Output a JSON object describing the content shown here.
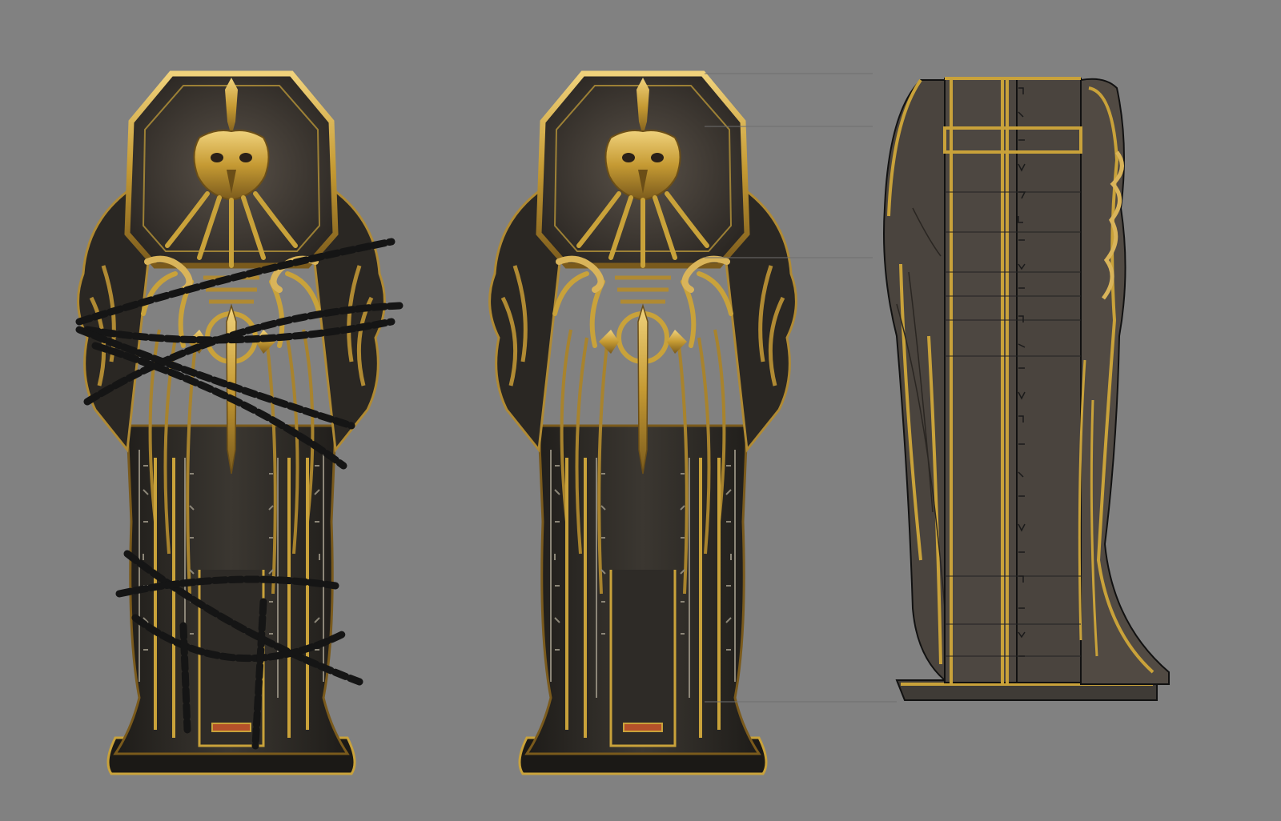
{
  "sheet": {
    "background": "#818181",
    "views": [
      {
        "name": "front-view-chained",
        "has_chains": true
      },
      {
        "name": "front-view-unchained",
        "has_chains": false
      },
      {
        "name": "side-view-line-art",
        "has_chains": false
      }
    ]
  },
  "palette": {
    "gold": "#c9a23a",
    "gold_light": "#e7c66a",
    "dark_body": "#2b2925",
    "panel": "#4a4640",
    "side_fill": "#4d4741",
    "chain": "#1a1a1a"
  },
  "icons": [
    "skull-face-icon",
    "sword-emblem-icon",
    "chain-icon",
    "hieroglyph-icon"
  ]
}
